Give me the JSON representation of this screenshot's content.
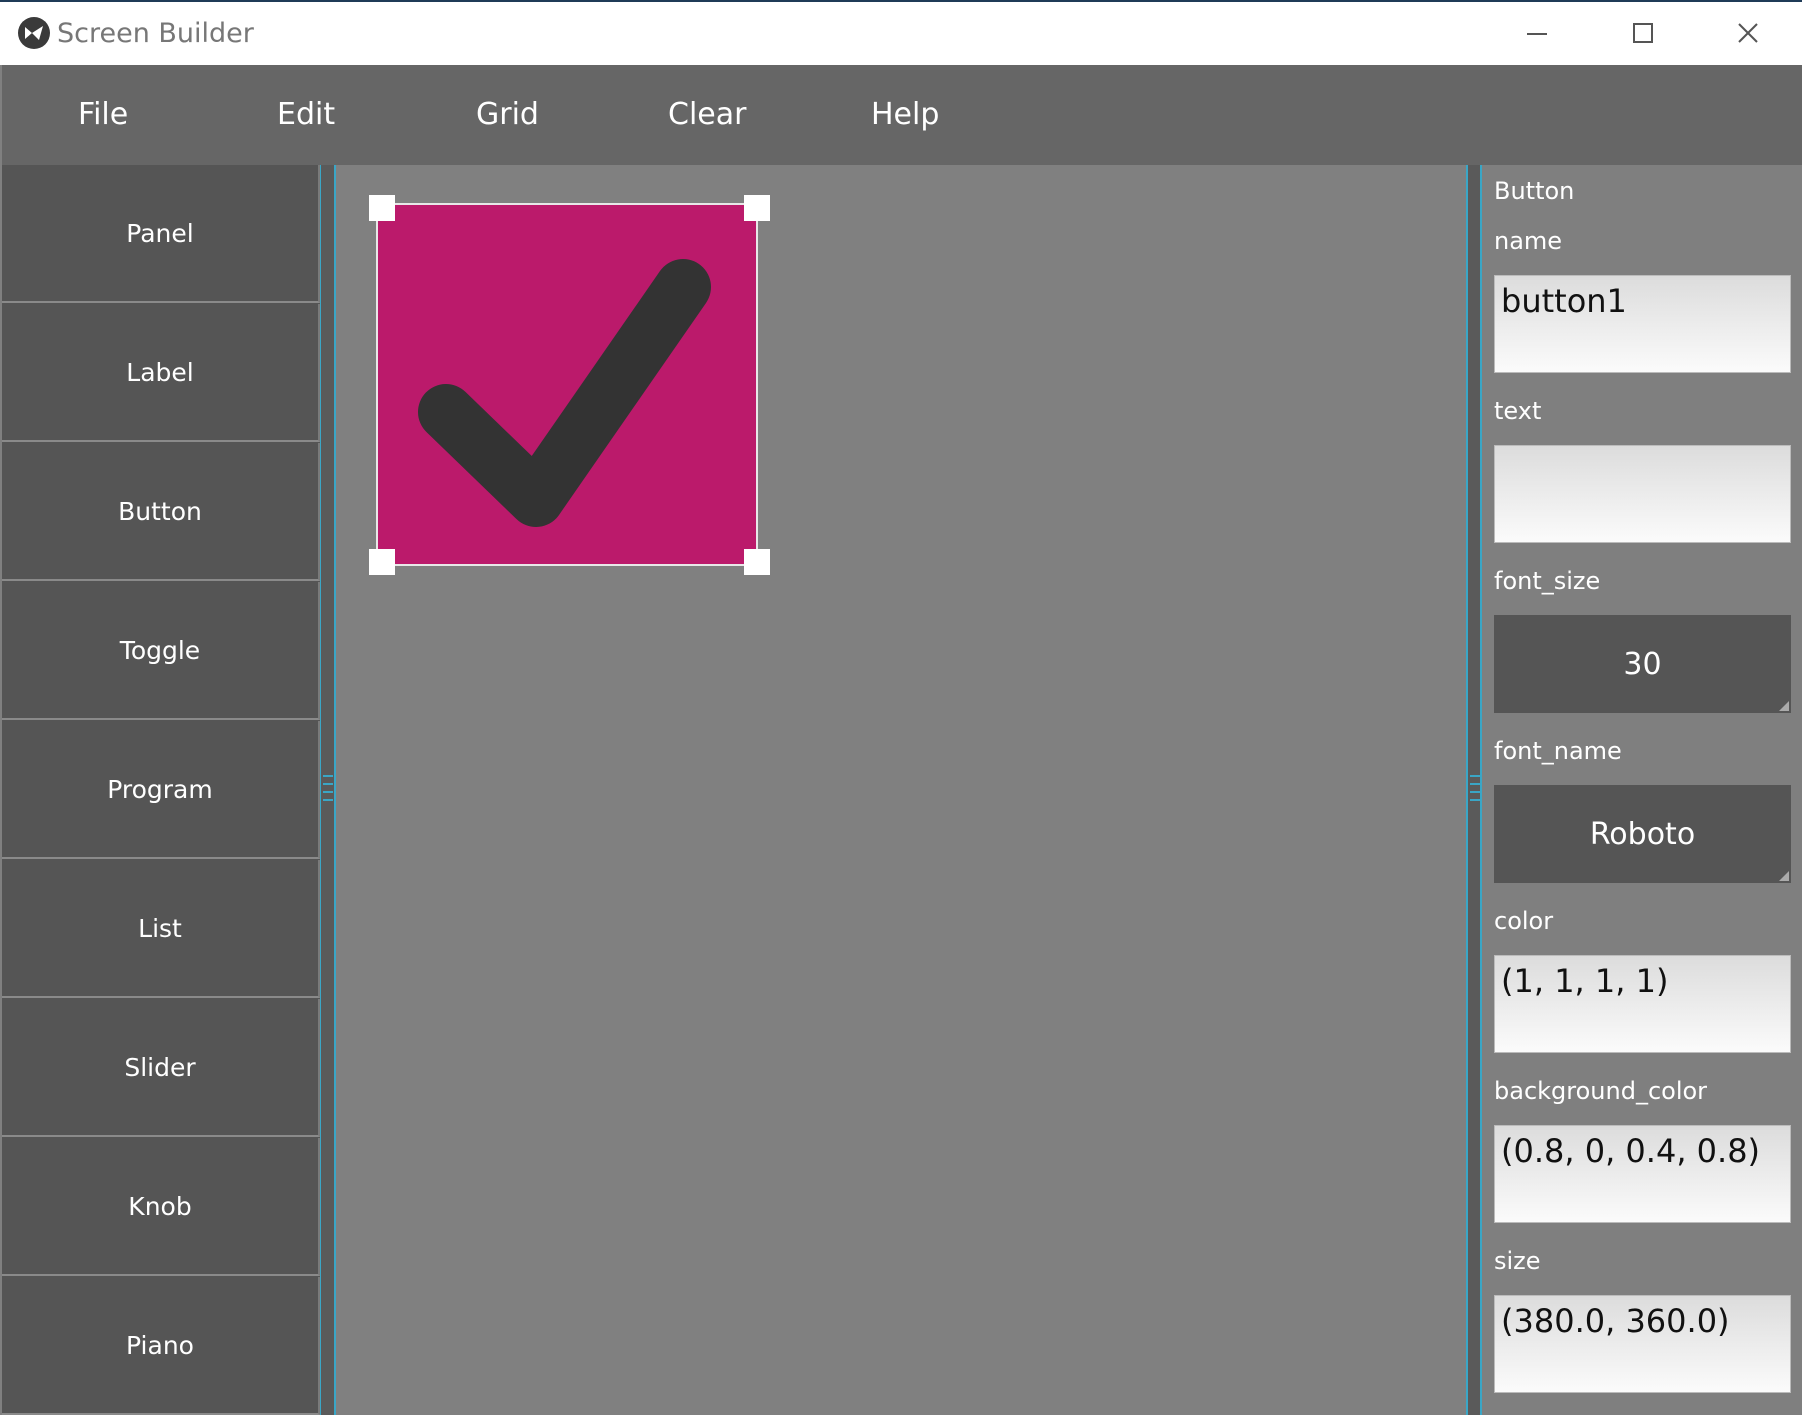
{
  "window": {
    "title": "Screen Builder"
  },
  "menu": [
    "File",
    "Edit",
    "Grid",
    "Clear",
    "Help"
  ],
  "palette": [
    "Panel",
    "Label",
    "Button",
    "Toggle",
    "Program",
    "List",
    "Slider",
    "Knob",
    "Piano"
  ],
  "canvas": {
    "selected_widget": {
      "type": "Button",
      "background": "#bb1a6b",
      "icon": "checkmark-icon"
    }
  },
  "properties": {
    "header": "Button",
    "name_label": "name",
    "name_value": "button1",
    "text_label": "text",
    "text_value": "",
    "font_size_label": "font_size",
    "font_size_value": "30",
    "font_name_label": "font_name",
    "font_name_value": "Roboto",
    "color_label": "color",
    "color_value": "(1, 1, 1, 1)",
    "background_color_label": "background_color",
    "background_color_value": "(0.8, 0, 0.4, 0.8)",
    "size_label": "size",
    "size_value": "(380.0, 360.0)"
  },
  "colors": {
    "menubar": "#666666",
    "palette": "#555555",
    "canvas": "#808080",
    "accent": "#3aa6c6",
    "widget": "#bb1a6b"
  }
}
